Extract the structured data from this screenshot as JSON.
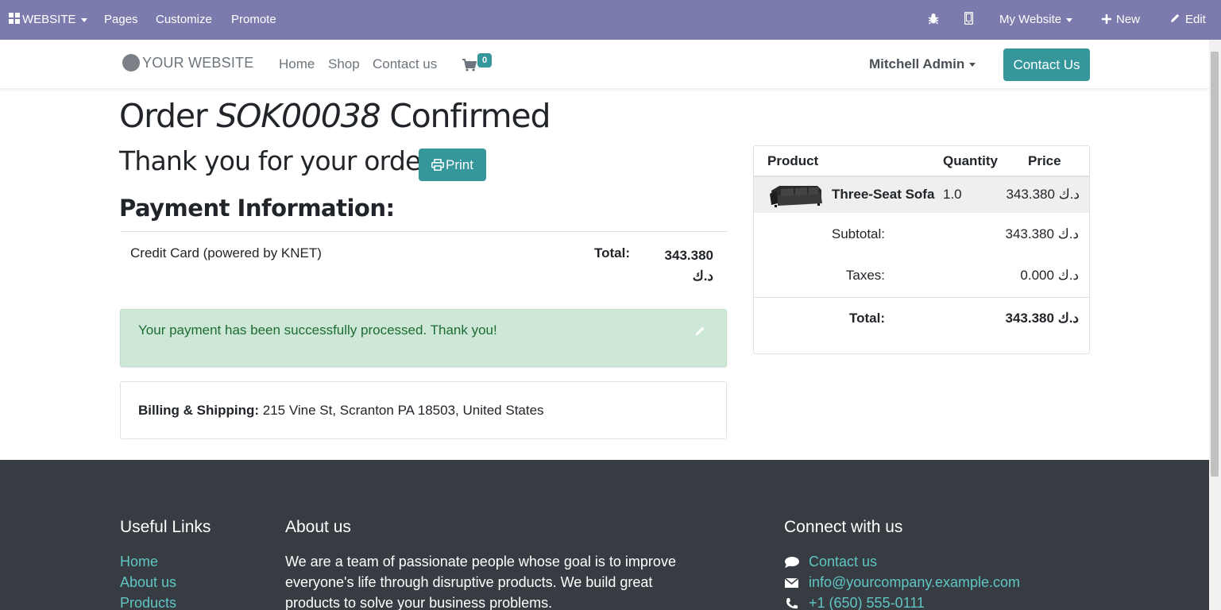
{
  "admin_bar": {
    "website_menu": "WEBSITE",
    "pages": "Pages",
    "customize": "Customize",
    "promote": "Promote",
    "site_selector": "My Website",
    "new": "New",
    "edit": "Edit",
    "icons": [
      "bug-icon",
      "mobile-icon",
      "plus-icon",
      "pencil-icon"
    ]
  },
  "navbar": {
    "logo_text": "YOUR WEBSITE",
    "links": [
      "Home",
      "Shop",
      "Contact us"
    ],
    "cart_count": "0",
    "user": "Mitchell Admin",
    "cta": "Contact Us"
  },
  "order": {
    "title_prefix": "Order",
    "number": "SOK00038",
    "title_suffix": "Confirmed",
    "thanks": "Thank you for your order.",
    "print": "Print"
  },
  "payment": {
    "heading": "Payment Information:",
    "method": "Credit Card (powered by KNET)",
    "total_label": "Total:",
    "total_amount": "343.380",
    "currency": "د.ك",
    "alert": "Your payment has been successfully processed. Thank you!"
  },
  "billing": {
    "label": "Billing & Shipping:",
    "address": "215 Vine St, Scranton PA 18503, United States"
  },
  "summary": {
    "headers": {
      "product": "Product",
      "quantity": "Quantity",
      "price": "Price"
    },
    "items": [
      {
        "name": "Three-Seat Sofa",
        "qty": "1.0",
        "price": "343.380 د.ك"
      }
    ],
    "subtotal_label": "Subtotal:",
    "subtotal": "343.380 د.ك",
    "taxes_label": "Taxes:",
    "taxes": "0.000 د.ك",
    "total_label": "Total:",
    "total": "343.380 د.ك"
  },
  "footer": {
    "useful_links_title": "Useful Links",
    "useful_links": [
      "Home",
      "About us",
      "Products"
    ],
    "about_title": "About us",
    "about_text": "We are a team of passionate people whose goal is to improve everyone's life through disruptive products. We build great products to solve your business problems.",
    "connect_title": "Connect with us",
    "contact_link": "Contact us",
    "email": "info@yourcompany.example.com",
    "phone": "+1 (650) 555-0111"
  },
  "colors": {
    "admin_bar": "#7c7bad",
    "primary": "#35979c",
    "alert_bg": "#cde8d6",
    "footer_bg": "#373b42",
    "footer_link": "#5fc6c4"
  }
}
